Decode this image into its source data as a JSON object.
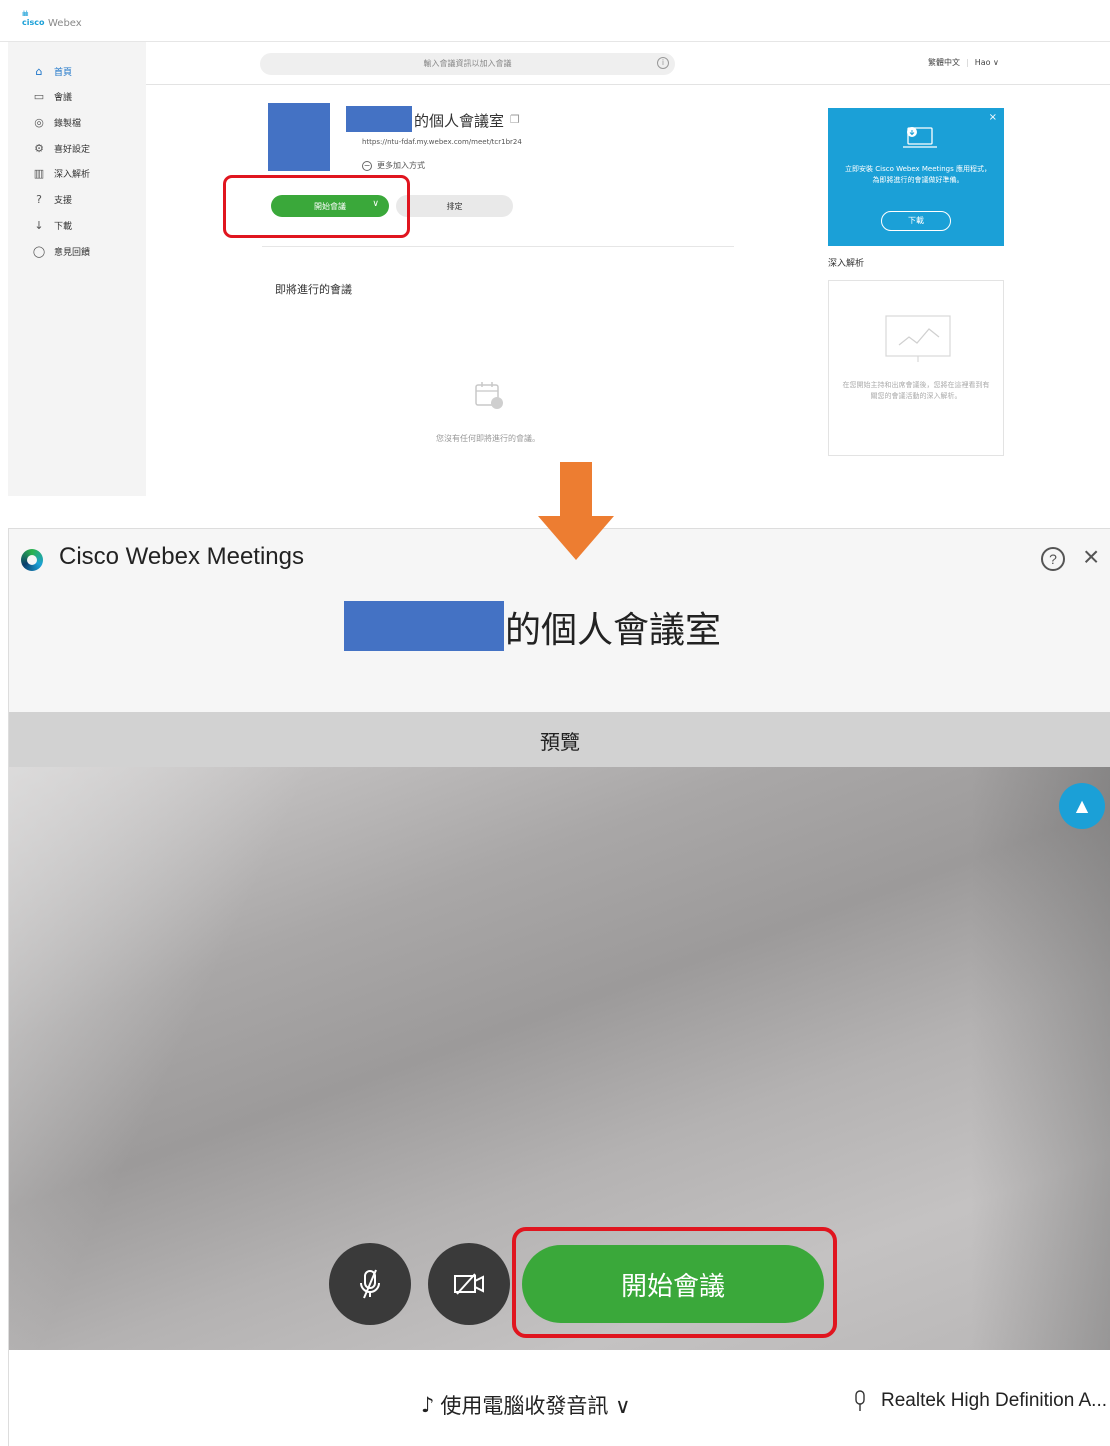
{
  "web": {
    "logo": {
      "bars": "ılıılı",
      "brand": "cisco",
      "product": "Webex"
    },
    "sidebar": {
      "items": [
        {
          "label": "首頁",
          "icon": "home-icon",
          "glyph": "⌂"
        },
        {
          "label": "會議",
          "icon": "meetings-icon",
          "glyph": "▭"
        },
        {
          "label": "錄製檔",
          "icon": "recordings-icon",
          "glyph": "◎"
        },
        {
          "label": "喜好設定",
          "icon": "settings-icon",
          "glyph": "⚙"
        },
        {
          "label": "深入解析",
          "icon": "insights-icon",
          "glyph": "▥"
        },
        {
          "label": "支援",
          "icon": "support-icon",
          "glyph": "?"
        },
        {
          "label": "下載",
          "icon": "download-icon",
          "glyph": "↓"
        },
        {
          "label": "意見回饋",
          "icon": "feedback-icon",
          "glyph": "◯"
        }
      ]
    },
    "search": {
      "placeholder": "輸入會議資訊以加入會議",
      "info_glyph": "i"
    },
    "header": {
      "language": "繁體中文",
      "user": "Hao ∨"
    },
    "room": {
      "title_suffix": "的個人會議室",
      "copy_glyph": "❐",
      "url": "https://ntu-fdaf.my.webex.com/meet/tcr1br24",
      "more_join_glyph": "−",
      "more_join": "更多加入方式",
      "start_label": "開始會議",
      "start_chevron": "∨",
      "schedule_label": "排定"
    },
    "upcoming": {
      "title": "即將進行的會議",
      "empty_text": "您沒有任何即將進行的會議。"
    },
    "promo": {
      "close_glyph": "×",
      "text": "立即安裝 Cisco Webex Meetings 應用程式，為即將進行的會議做好準備。",
      "button": "下載"
    },
    "insights": {
      "title": "深入解析",
      "text": "在您開始主持和出席會議後，您將在這裡看到有關您的會議活動的深入解析。"
    }
  },
  "app": {
    "name": "Cisco Webex Meetings",
    "help_glyph": "?",
    "close_glyph": "×",
    "meeting_title_suffix": "的個人會議室",
    "preview_label": "預覽",
    "float_glyph": "▲",
    "start_label": "開始會議",
    "audio_glyph": "♪",
    "audio_option": "使用電腦收發音訊 ∨",
    "mic_glyph": "🎙",
    "audio_device": "Realtek High Definition A..."
  },
  "colors": {
    "accent_blue": "#1ba0d7",
    "start_green": "#3aa83a",
    "highlight_red": "#e0151f",
    "arrow_orange": "#ed7d31",
    "redaction_blue": "#4472c4"
  }
}
